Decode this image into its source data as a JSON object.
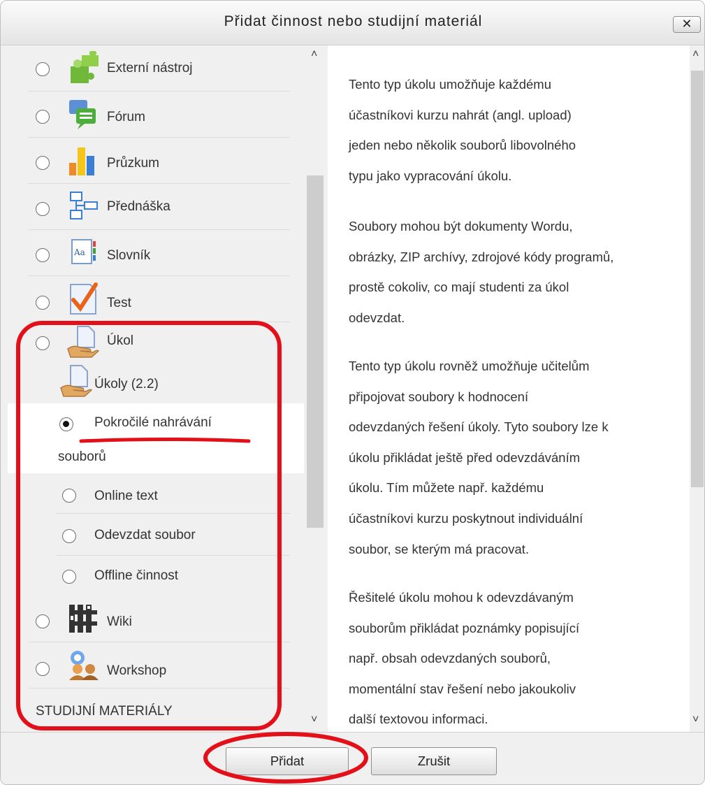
{
  "dialog": {
    "title": "Přidat činnost nebo studijní materiál",
    "close_label": "✕"
  },
  "activities": [
    {
      "label": "Externí nástroj",
      "icon": "puzzle-icon"
    },
    {
      "label": "Fórum",
      "icon": "forum-icon"
    },
    {
      "label": "Průzkum",
      "icon": "bar-chart-icon"
    },
    {
      "label": "Přednáška",
      "icon": "lesson-icon"
    },
    {
      "label": "Slovník",
      "icon": "glossary-icon"
    },
    {
      "label": "Test",
      "icon": "quiz-icon"
    },
    {
      "label": "Úkol",
      "icon": "assignment-icon"
    }
  ],
  "assignment_legacy": {
    "label": "Úkoly (2.2)",
    "icon": "assignment-icon",
    "selected": {
      "label_line1": "Pokročilé nahrávání",
      "label_line2": "souborů"
    },
    "subtypes": [
      {
        "label": "Online text"
      },
      {
        "label": "Odevzdat soubor"
      },
      {
        "label": "Offline činnost"
      }
    ]
  },
  "activities_after": [
    {
      "label": "Wiki",
      "icon": "wiki-icon"
    },
    {
      "label": "Workshop",
      "icon": "workshop-icon"
    }
  ],
  "resources_heading": "STUDIJNÍ MATERIÁLY",
  "description": {
    "paragraphs": [
      [
        "Tento typ úkolu umožňuje každému",
        "účastníkovi kurzu nahrát (angl. upload)",
        "jeden nebo několik souborů libovolného",
        "typu jako vypracování úkolu."
      ],
      [
        "Soubory mohou být dokumenty Wordu,",
        "obrázky, ZIP archívy, zdrojové kódy programů,",
        "prostě cokoliv, co mají studenti za úkol",
        "odevzdat."
      ],
      [
        "Tento typ úkolu rovněž umožňuje učitelům",
        "připojovat soubory k hodnocení",
        "odevzdaných řešení úkoly. Tyto soubory lze k",
        "úkolu přikládat ještě před odevzdáváním",
        "úkolu. Tím můžete např. každému",
        "účastníkovi kurzu poskytnout individuální",
        "soubor, se kterým má pracovat."
      ],
      [
        "Řešitelé úkolu mohou k odevzdávaným",
        "souborům přikládat poznámky popisující",
        "např. obsah odevzdaných souborů,",
        "momentální stav řešení nebo jakoukoliv",
        "další textovou informaci."
      ]
    ]
  },
  "footer": {
    "add_label": "Přidat",
    "cancel_label": "Zrušit"
  },
  "colors": {
    "annotation": "#e3101a",
    "header_bg": "#e8e8e8",
    "pane_bg": "#f0f0f0"
  }
}
